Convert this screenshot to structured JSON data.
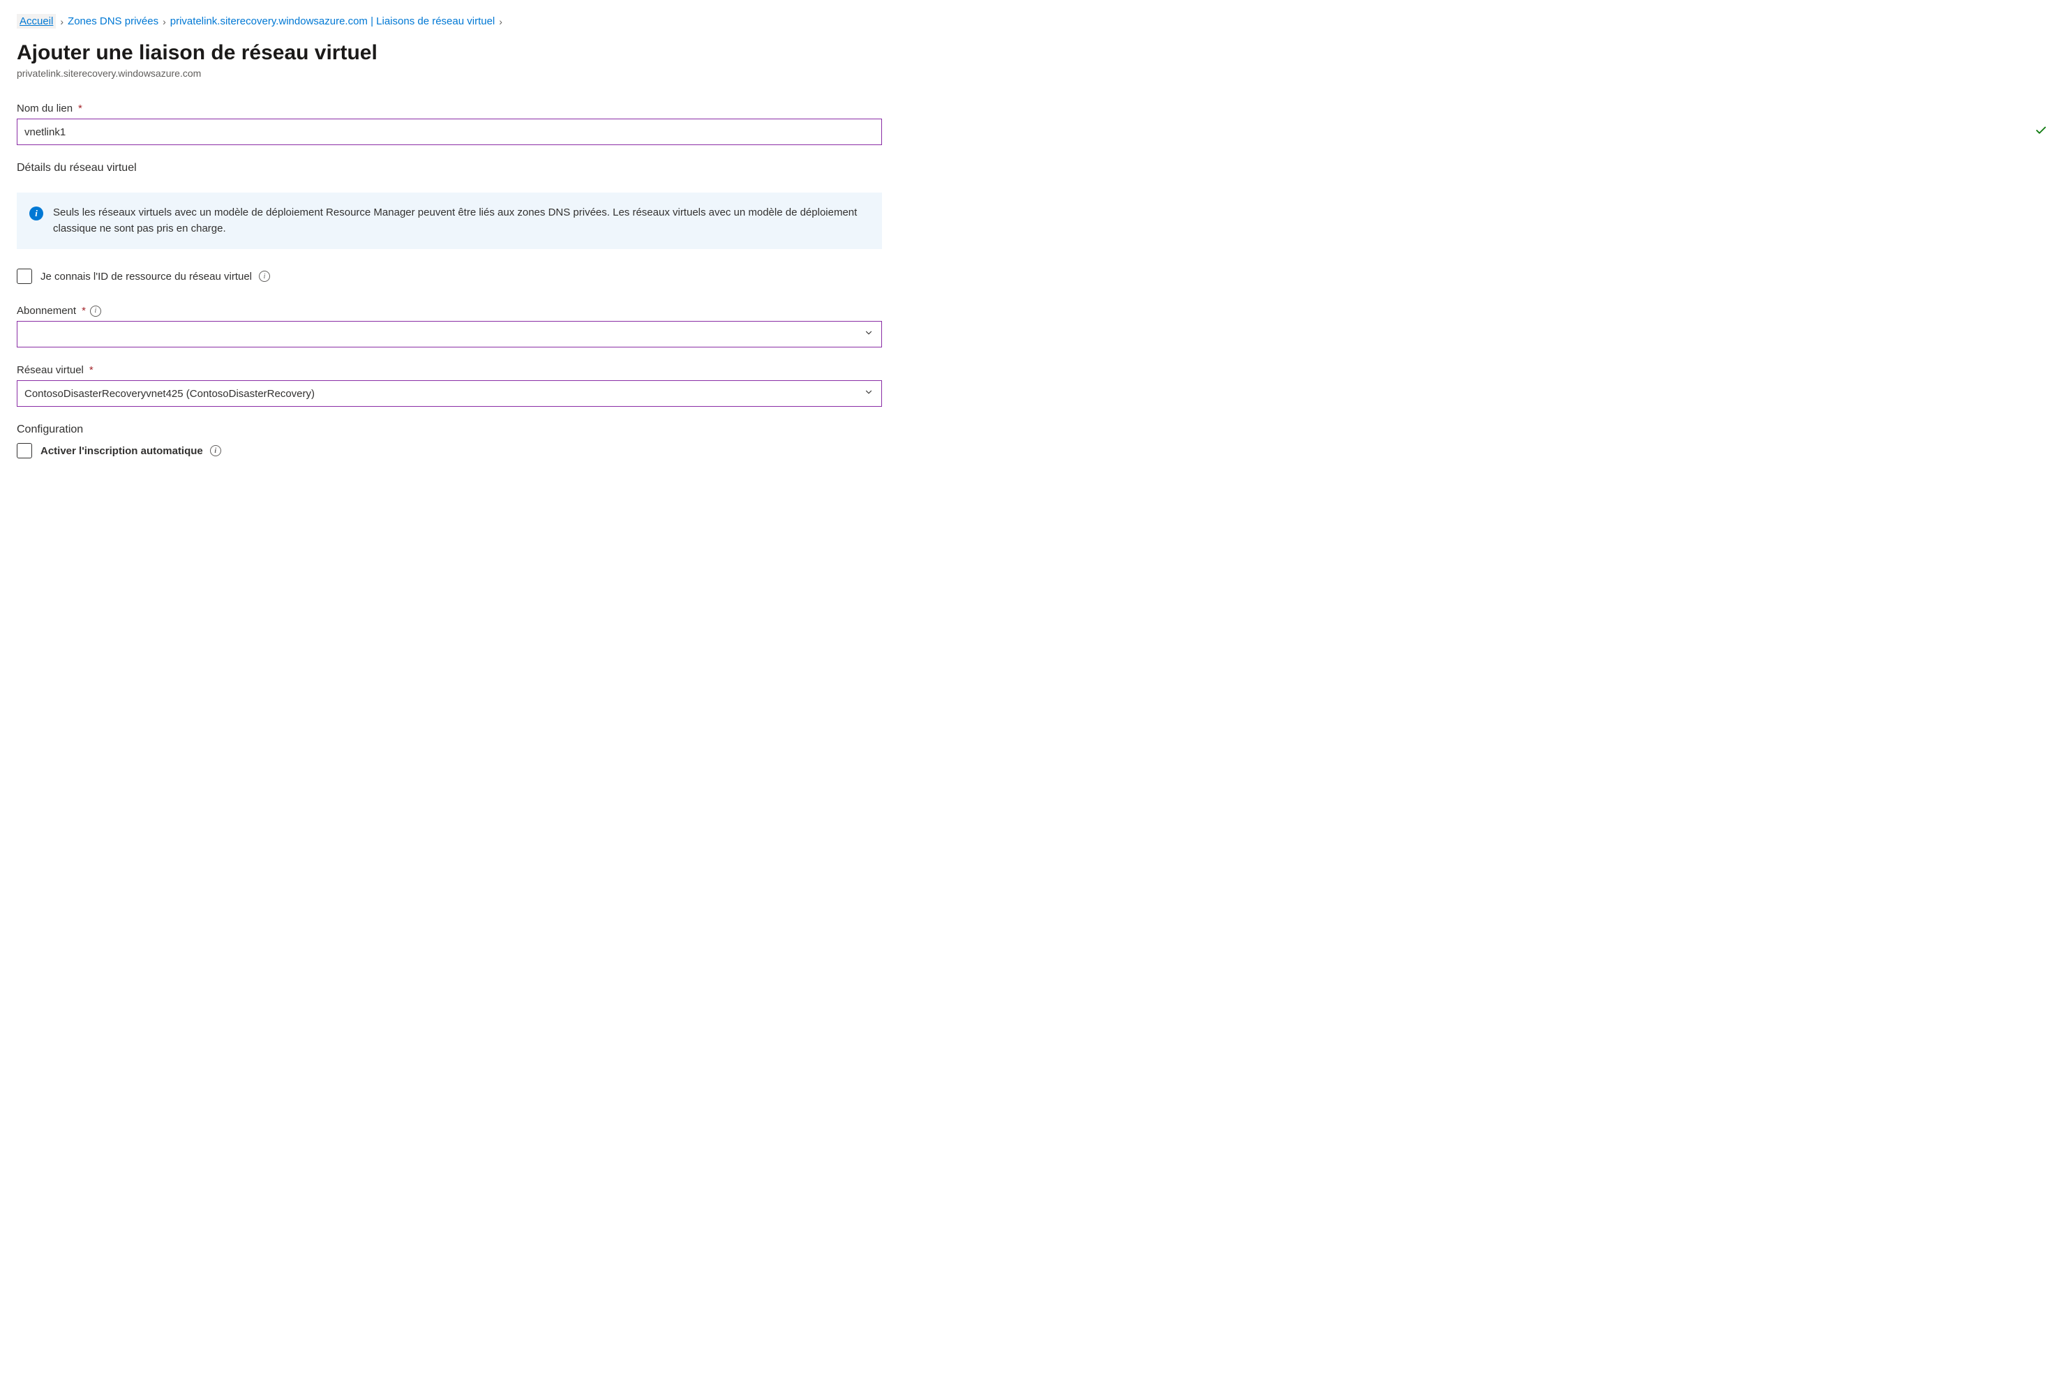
{
  "breadcrumb": {
    "items": [
      {
        "label": "Accueil"
      },
      {
        "label": "Zones DNS privées"
      },
      {
        "label": "privatelink.siterecovery.windowsazure.com | Liaisons de réseau virtuel"
      }
    ]
  },
  "header": {
    "title": "Ajouter une liaison de réseau virtuel",
    "subtitle": "privatelink.siterecovery.windowsazure.com"
  },
  "form": {
    "linkName": {
      "label": "Nom du lien",
      "value": "vnetlink1"
    },
    "vnetDetailsTitle": "Détails du réseau virtuel",
    "infoMessage": "Seuls les réseaux virtuels avec un modèle de déploiement Resource Manager peuvent être liés aux zones DNS privées. Les réseaux virtuels avec un modèle de déploiement classique ne sont pas pris en charge.",
    "knowResourceId": {
      "label": "Je connais l'ID de ressource du réseau virtuel"
    },
    "subscription": {
      "label": "Abonnement",
      "value": ""
    },
    "virtualNetwork": {
      "label": "Réseau virtuel",
      "value": "ContosoDisasterRecoveryvnet425 (ContosoDisasterRecovery)"
    },
    "configurationTitle": "Configuration",
    "autoRegistration": {
      "label": "Activer l'inscription automatique"
    }
  }
}
